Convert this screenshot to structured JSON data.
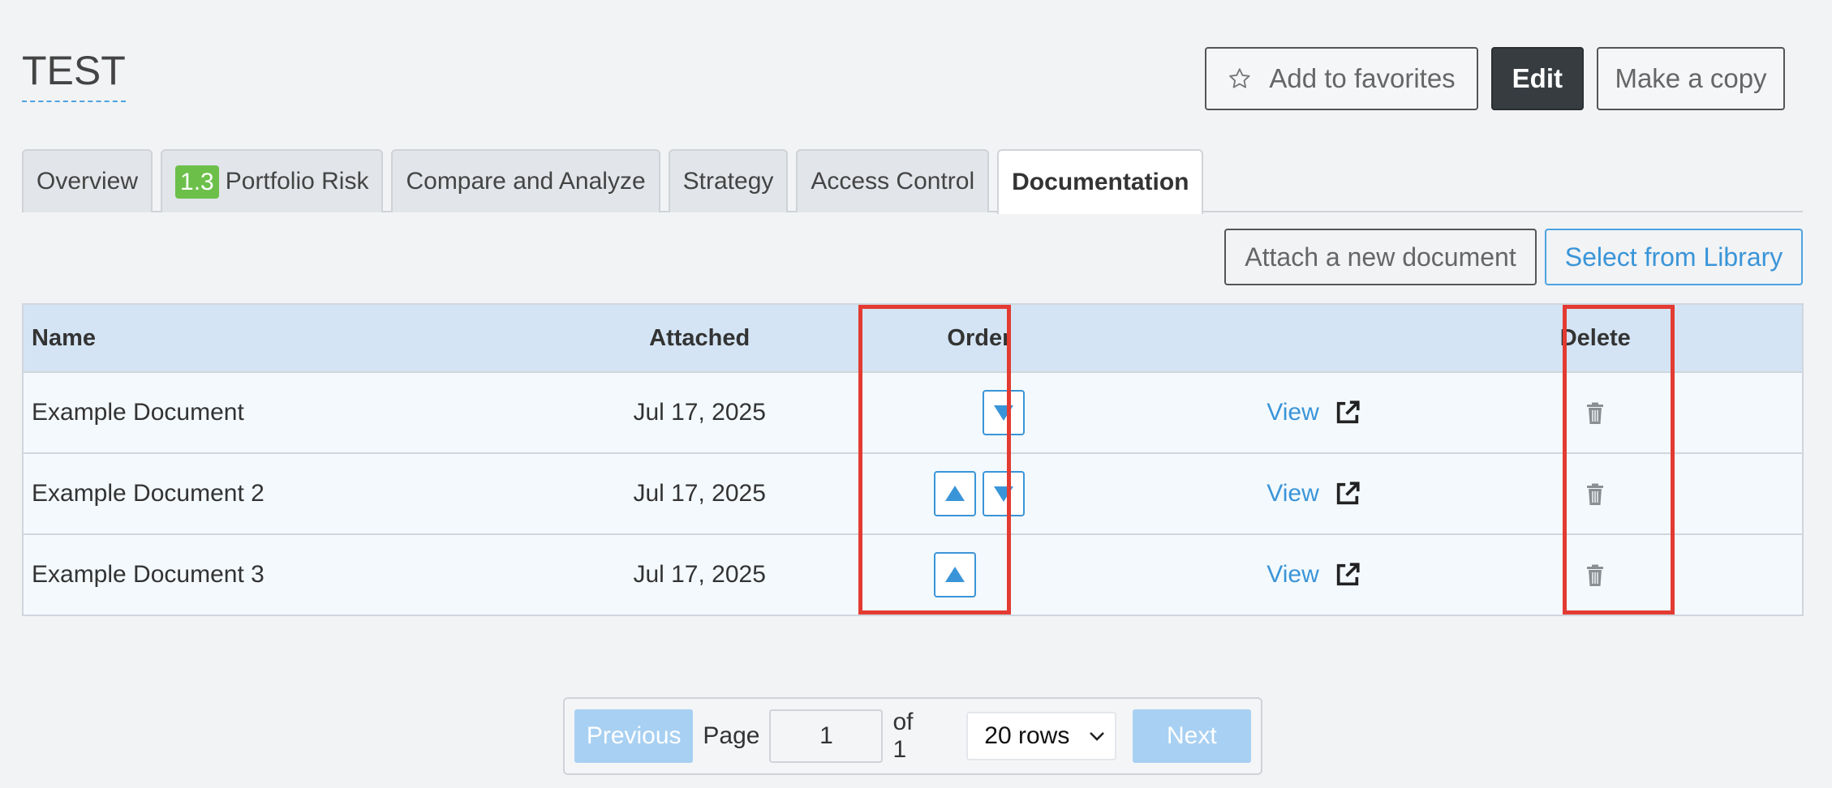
{
  "page": {
    "title": "TEST"
  },
  "header": {
    "favorites_label": "Add to favorites",
    "edit_label": "Edit",
    "copy_label": "Make a copy"
  },
  "tabs": [
    {
      "label": "Overview"
    },
    {
      "badge": "1.3",
      "label": "Portfolio Risk"
    },
    {
      "label": "Compare and Analyze"
    },
    {
      "label": "Strategy"
    },
    {
      "label": "Access Control"
    },
    {
      "label": "Documentation",
      "active": true
    }
  ],
  "documents": {
    "attach_label": "Attach a new document",
    "library_label": "Select from Library",
    "columns": {
      "name": "Name",
      "attached": "Attached",
      "order": "Order",
      "delete": "Delete"
    },
    "rows": [
      {
        "name": "Example Document",
        "attached": "Jul 17, 2025",
        "view": "View"
      },
      {
        "name": "Example Document 2",
        "attached": "Jul 17, 2025",
        "view": "View"
      },
      {
        "name": "Example Document 3",
        "attached": "Jul 17, 2025",
        "view": "View"
      }
    ]
  },
  "pagination": {
    "previous": "Previous",
    "page_label": "Page",
    "page_value": "1",
    "of_label": "of 1",
    "rows_option": "20 rows",
    "next": "Next"
  },
  "icons": {
    "favorite": "star-icon",
    "view": "external-link-icon",
    "delete": "trash-icon",
    "move_up": "triangle-up-icon",
    "move_down": "triangle-down-icon",
    "select": "chevron-down-icon"
  },
  "colors": {
    "accent": "#3a95d8",
    "highlight": "#e33b32",
    "badge": "#6cc04a",
    "header_row": "#d4e4f4"
  }
}
